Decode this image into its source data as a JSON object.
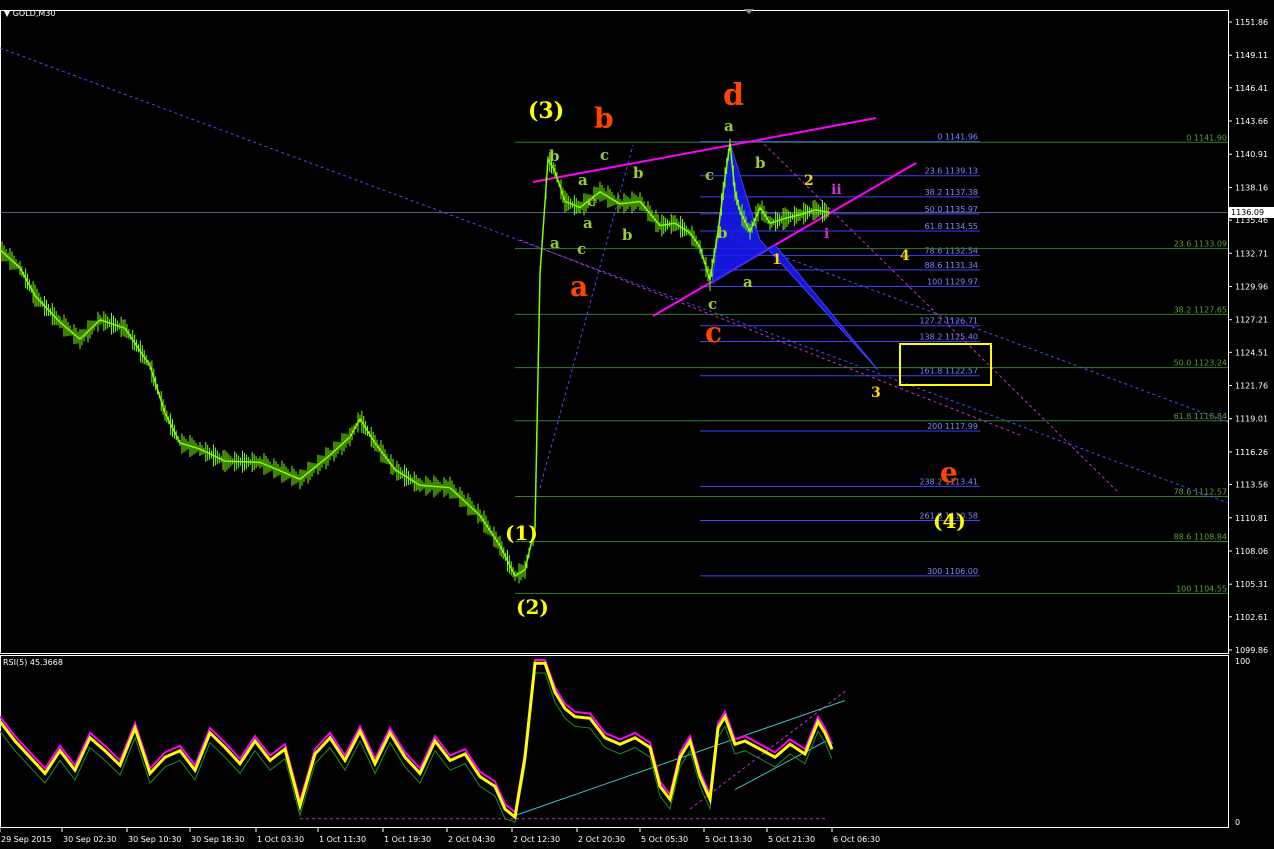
{
  "symbol": "GOLD,M30",
  "price_tag": "1136.09",
  "chart_data": {
    "type": "candlestick",
    "title": "GOLD,M30",
    "ylim": [
      1099.86,
      1151.86
    ],
    "y_ticks": [
      "1151.86",
      "1149.11",
      "1146.41",
      "1143.66",
      "1140.91",
      "1138.16",
      "1135.46",
      "1132.71",
      "1129.96",
      "1127.21",
      "1124.51",
      "1121.76",
      "1119.01",
      "1116.26",
      "1113.56",
      "1110.81",
      "1108.06",
      "1105.31",
      "1102.61",
      "1099.86"
    ],
    "x_ticks": [
      "29 Sep 2015",
      "30 Sep 02:30",
      "30 Sep 10:30",
      "30 Sep 18:30",
      "1 Oct 03:30",
      "1 Oct 11:30",
      "1 Oct 19:30",
      "2 Oct 04:30",
      "2 Oct 12:30",
      "2 Oct 20:30",
      "5 Oct 05:30",
      "5 Oct 13:30",
      "5 Oct 21:30",
      "6 Oct 06:30"
    ],
    "fib_blue": [
      {
        "label": "0 1141.96",
        "price": 1141.96
      },
      {
        "label": "23.6 1139.13",
        "price": 1139.13
      },
      {
        "label": "38.2 1137.38",
        "price": 1137.38
      },
      {
        "label": "50.0 1135.97",
        "price": 1135.97
      },
      {
        "label": "61.8 1134.55",
        "price": 1134.55
      },
      {
        "label": "78.6 1132.54",
        "price": 1132.54
      },
      {
        "label": "88.6 1131.34",
        "price": 1131.34
      },
      {
        "label": "100 1129.97",
        "price": 1129.97
      },
      {
        "label": "127.2 1126.71",
        "price": 1126.71
      },
      {
        "label": "138.2 1125.40",
        "price": 1125.4
      },
      {
        "label": "161.8 1122.57",
        "price": 1122.57
      },
      {
        "label": "200 1117.99",
        "price": 1117.99
      },
      {
        "label": "238.2 1113.41",
        "price": 1113.41
      },
      {
        "label": "261.8 1110.58",
        "price": 1110.58
      },
      {
        "label": "300 1106.00",
        "price": 1106.0
      }
    ],
    "fib_green": [
      {
        "label": "0 1141.90",
        "price": 1141.9
      },
      {
        "label": "23.6 1133.09",
        "price": 1133.09
      },
      {
        "label": "38.2 1127.65",
        "price": 1127.65
      },
      {
        "label": "50.0 1123.24",
        "price": 1123.24
      },
      {
        "label": "61.8 1118.84",
        "price": 1118.84
      },
      {
        "label": "78.6 1112.57",
        "price": 1112.57
      },
      {
        "label": "88.6 1108.84",
        "price": 1108.84
      },
      {
        "label": "100 1104.55",
        "price": 1104.55
      }
    ],
    "price_path": [
      [
        0,
        1133.0
      ],
      [
        20,
        1131.5
      ],
      [
        35,
        1129.2
      ],
      [
        60,
        1127.0
      ],
      [
        80,
        1125.6
      ],
      [
        100,
        1127.2
      ],
      [
        125,
        1126.5
      ],
      [
        150,
        1123.4
      ],
      [
        165,
        1119.5
      ],
      [
        180,
        1117.0
      ],
      [
        200,
        1116.5
      ],
      [
        225,
        1115.5
      ],
      [
        260,
        1115.4
      ],
      [
        300,
        1114.0
      ],
      [
        330,
        1116.0
      ],
      [
        350,
        1117.5
      ],
      [
        360,
        1119.0
      ],
      [
        375,
        1117.0
      ],
      [
        395,
        1114.8
      ],
      [
        420,
        1113.5
      ],
      [
        450,
        1113.3
      ],
      [
        480,
        1111.0
      ],
      [
        500,
        1108.5
      ],
      [
        515,
        1106.0
      ],
      [
        525,
        1106.5
      ],
      [
        535,
        1110.0
      ],
      [
        540,
        1131.0
      ],
      [
        548,
        1140.5
      ],
      [
        555,
        1139.5
      ],
      [
        565,
        1137.0
      ],
      [
        580,
        1136.5
      ],
      [
        600,
        1137.8
      ],
      [
        620,
        1136.8
      ],
      [
        640,
        1137.0
      ],
      [
        660,
        1135.0
      ],
      [
        675,
        1135.2
      ],
      [
        690,
        1134.4
      ],
      [
        700,
        1133.2
      ],
      [
        710,
        1130.5
      ],
      [
        718,
        1134.5
      ],
      [
        725,
        1139.0
      ],
      [
        730,
        1141.8
      ],
      [
        735,
        1137.8
      ],
      [
        740,
        1136.2
      ],
      [
        750,
        1134.5
      ],
      [
        760,
        1136.5
      ],
      [
        770,
        1135.2
      ],
      [
        785,
        1135.6
      ],
      [
        800,
        1135.9
      ],
      [
        815,
        1136.3
      ],
      [
        830,
        1136.09
      ]
    ],
    "rsi": {
      "label": "RSI(5) 45.3668",
      "ylim": [
        0,
        100
      ],
      "y_ticks": [
        "100",
        "0"
      ],
      "path": [
        [
          0,
          62
        ],
        [
          15,
          50
        ],
        [
          30,
          40
        ],
        [
          45,
          30
        ],
        [
          60,
          44
        ],
        [
          75,
          32
        ],
        [
          90,
          52
        ],
        [
          105,
          44
        ],
        [
          120,
          35
        ],
        [
          135,
          58
        ],
        [
          150,
          30
        ],
        [
          165,
          40
        ],
        [
          180,
          44
        ],
        [
          195,
          32
        ],
        [
          210,
          55
        ],
        [
          225,
          46
        ],
        [
          240,
          36
        ],
        [
          255,
          50
        ],
        [
          270,
          38
        ],
        [
          285,
          45
        ],
        [
          300,
          10
        ],
        [
          315,
          42
        ],
        [
          330,
          52
        ],
        [
          345,
          38
        ],
        [
          360,
          56
        ],
        [
          375,
          36
        ],
        [
          390,
          55
        ],
        [
          405,
          40
        ],
        [
          420,
          30
        ],
        [
          435,
          50
        ],
        [
          450,
          38
        ],
        [
          465,
          42
        ],
        [
          480,
          28
        ],
        [
          495,
          22
        ],
        [
          505,
          8
        ],
        [
          515,
          3
        ],
        [
          525,
          40
        ],
        [
          535,
          98
        ],
        [
          545,
          98
        ],
        [
          555,
          80
        ],
        [
          565,
          70
        ],
        [
          575,
          65
        ],
        [
          590,
          64
        ],
        [
          605,
          52
        ],
        [
          620,
          48
        ],
        [
          635,
          52
        ],
        [
          650,
          46
        ],
        [
          660,
          22
        ],
        [
          670,
          14
        ],
        [
          680,
          40
        ],
        [
          690,
          50
        ],
        [
          700,
          28
        ],
        [
          710,
          14
        ],
        [
          718,
          58
        ],
        [
          725,
          65
        ],
        [
          735,
          48
        ],
        [
          745,
          50
        ],
        [
          760,
          45
        ],
        [
          775,
          40
        ],
        [
          790,
          48
        ],
        [
          805,
          42
        ],
        [
          818,
          62
        ],
        [
          825,
          55
        ],
        [
          832,
          45
        ]
      ]
    },
    "annotations": [
      {
        "text": "(3)",
        "color": "#ffff00"
      },
      {
        "text": "(1)",
        "color": "#ffff00"
      },
      {
        "text": "(2)",
        "color": "#ffff00"
      },
      {
        "text": "(4)",
        "color": "#ffff00"
      },
      {
        "text": "a",
        "color": "#ff4500"
      },
      {
        "text": "b",
        "color": "#ff4500"
      },
      {
        "text": "c",
        "color": "#ff4500"
      },
      {
        "text": "d",
        "color": "#ff4500"
      },
      {
        "text": "e",
        "color": "#ff4500"
      },
      {
        "text": "b",
        "color": "#9acd32"
      },
      {
        "text": "c",
        "color": "#9acd32"
      },
      {
        "text": "a",
        "color": "#9acd32"
      },
      {
        "text": "b",
        "color": "#9acd32"
      },
      {
        "text": "a",
        "color": "#9acd32"
      },
      {
        "text": "b",
        "color": "#9acd32"
      },
      {
        "text": "c",
        "color": "#9acd32"
      },
      {
        "text": "a",
        "color": "#9acd32"
      },
      {
        "text": "c",
        "color": "#9acd32"
      },
      {
        "text": "a",
        "color": "#9acd32"
      },
      {
        "text": "b",
        "color": "#9acd32"
      },
      {
        "text": "c",
        "color": "#9acd32"
      },
      {
        "text": "b",
        "color": "#9acd32"
      },
      {
        "text": "a",
        "color": "#9acd32"
      },
      {
        "text": "c",
        "color": "#9acd32"
      },
      {
        "text": "2",
        "color": "#ffd700"
      },
      {
        "text": "1",
        "color": "#ffd700"
      },
      {
        "text": "3",
        "color": "#ffd700"
      },
      {
        "text": "4",
        "color": "#ffd700"
      },
      {
        "text": "ii",
        "color": "#cc33cc"
      },
      {
        "text": "i",
        "color": "#cc33cc"
      }
    ]
  },
  "colors": {
    "background": "#000000",
    "candle": "#7fff00",
    "axis": "#ffffff",
    "fib_blue": "#4040ff",
    "fib_green": "#2e7d32",
    "trendline": "#ff00ff",
    "rsi": "#ffff00",
    "rsi_signal": "#ff00ff",
    "rsi_band": "#228b22"
  }
}
